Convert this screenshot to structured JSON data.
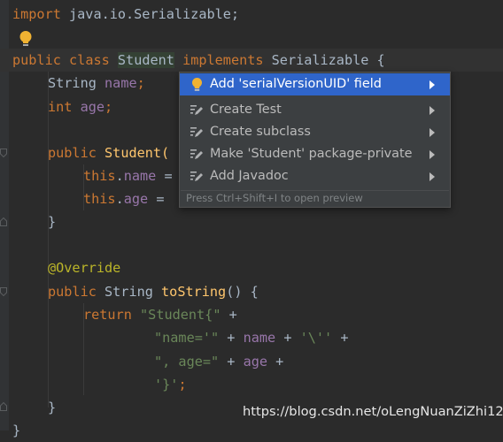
{
  "code": {
    "l1_kw": "import",
    "l1_rest": " java.io.Serializable;",
    "l3_public": "public",
    "l3_class": "class",
    "l3_name": "Student",
    "l3_implements": "implements",
    "l3_rest": " Serializable {",
    "l4_type": "String",
    "l4_field": "name",
    "l4_end": ";",
    "l5_type": "int",
    "l5_field": "age",
    "l5_end": ";",
    "l7_public": "public",
    "l7_ctor": "Student(",
    "l8_this": "this",
    "l8_dot": ".",
    "l8_field": "name",
    "l8_eq": " =",
    "l9_this": "this",
    "l9_dot": ".",
    "l9_field": "age",
    "l9_eq": " = ",
    "l10": "}",
    "l12": "@Override",
    "l13_public": "public",
    "l13_type": " String ",
    "l13_method": "toString",
    "l13_rest": "() {",
    "l14_return": "return",
    "l14_str": "\"Student{\"",
    "l14_plus": " +",
    "l15_str": "\"name='\"",
    "l15_plus1": " + ",
    "l15_field": "name",
    "l15_plus2": " + ",
    "l15_str2": "'\\''",
    "l15_plus3": " +",
    "l16_str": "\", age=\"",
    "l16_plus1": " + ",
    "l16_field": "age",
    "l16_plus2": " +",
    "l17_str": "'}'",
    "l17_end": ";",
    "l18": "}",
    "l19": "}"
  },
  "popup": {
    "items": [
      {
        "label": "Add 'serialVersionUID' field",
        "icon": "lightbulb-icon",
        "selected": true
      },
      {
        "label": "Create Test",
        "icon": "edit-intention-icon"
      },
      {
        "label": "Create subclass",
        "icon": "edit-intention-icon"
      },
      {
        "label": "Make 'Student' package-private",
        "icon": "edit-intention-icon"
      },
      {
        "label": "Add Javadoc",
        "icon": "edit-intention-icon"
      }
    ],
    "hint": "Press Ctrl+Shift+I to open preview"
  },
  "watermark": "https://blog.csdn.net/oLengNuanZiZhi12",
  "colors": {
    "background": "#2b2b2b",
    "keyword": "#cc7832",
    "field": "#9876aa",
    "string": "#6a8759",
    "annotation": "#bbb529",
    "method": "#ffc66d",
    "selection": "#2f65ca",
    "bulb": "#f0b232"
  }
}
